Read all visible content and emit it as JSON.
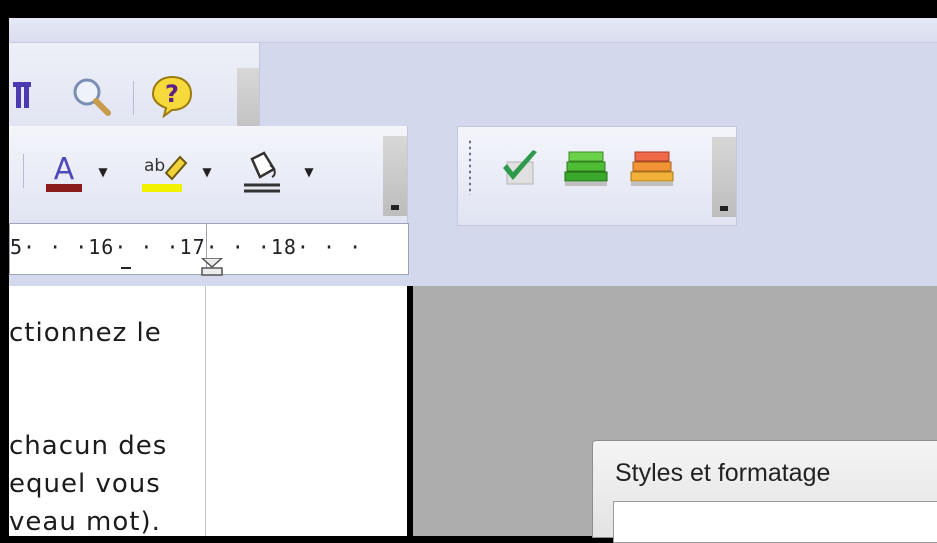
{
  "toolbar": {
    "row1": {
      "formatting_marks_icon": "pilcrow-icon",
      "zoom_icon": "magnifier-icon",
      "help_icon": "help-icon"
    },
    "row2": {
      "font_color_icon": "font-color-icon",
      "font_color_glyph": "A",
      "font_color_accent": "#8a1b1b",
      "highlight_icon": "highlighter-icon",
      "highlight_glyph": "ab",
      "highlight_accent": "#f2f200",
      "bg_color_icon": "fill-bucket-icon",
      "dropdown_glyph": "▼"
    },
    "row2b": {
      "check_icon": "checkmark-icon",
      "green_books_icon": "green-books-icon",
      "red_books_icon": "red-books-icon"
    }
  },
  "ruler": {
    "text": "5· · ·16· · ·17· · ·18· · ·"
  },
  "document": {
    "lines": [
      "ctionnez le",
      "",
      "chacun des",
      "equel vous",
      "veau mot)."
    ]
  },
  "dialog": {
    "title": "Styles et formatage"
  }
}
